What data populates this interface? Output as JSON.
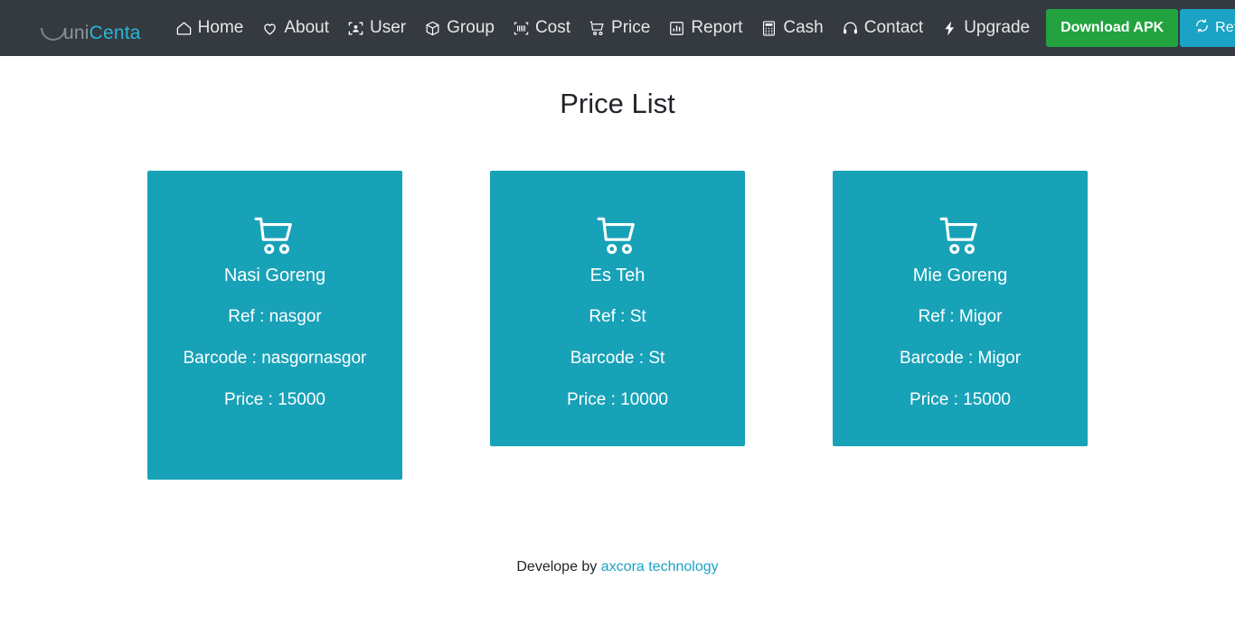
{
  "navbar": {
    "brand": {
      "part1": "uni",
      "part2": "Centa",
      "logo_icon": "ring-logo-icon"
    },
    "links": [
      {
        "label": "Home",
        "icon": "home-icon"
      },
      {
        "label": "About",
        "icon": "heart-icon"
      },
      {
        "label": "User",
        "icon": "user-frame-icon"
      },
      {
        "label": "Group",
        "icon": "box-icon"
      },
      {
        "label": "Cost",
        "icon": "barcode-icon"
      },
      {
        "label": "Price",
        "icon": "shopping-cart-icon"
      },
      {
        "label": "Report",
        "icon": "chart-box-icon"
      },
      {
        "label": "Cash",
        "icon": "calculator-icon"
      },
      {
        "label": "Contact",
        "icon": "headset-icon"
      },
      {
        "label": "Upgrade",
        "icon": "lightning-bolt-icon"
      }
    ],
    "download_button": {
      "label": "Download APK",
      "color": "#22a33f"
    },
    "refresh_button": {
      "label": "Refresh",
      "icon": "refresh-icon",
      "color": "#1aa3c4"
    },
    "background": "#343a40"
  },
  "main": {
    "title": "Price List",
    "card_color": "#17a2b8",
    "cards": [
      {
        "icon": "shopping-cart-icon",
        "name": "Nasi Goreng",
        "ref": "Ref : nasgor",
        "barcode": "Barcode : nasgornasgor",
        "price": "Price : 15000"
      },
      {
        "icon": "shopping-cart-icon",
        "name": "Es Teh",
        "ref": "Ref : St",
        "barcode": "Barcode : St",
        "price": "Price : 10000"
      },
      {
        "icon": "shopping-cart-icon",
        "name": "Mie Goreng",
        "ref": "Ref : Migor",
        "barcode": "Barcode : Migor",
        "price": "Price : 15000"
      }
    ]
  },
  "footer": {
    "text": "Develope by",
    "link_label": "axcora technology",
    "link_color": "#1aa3c4"
  }
}
